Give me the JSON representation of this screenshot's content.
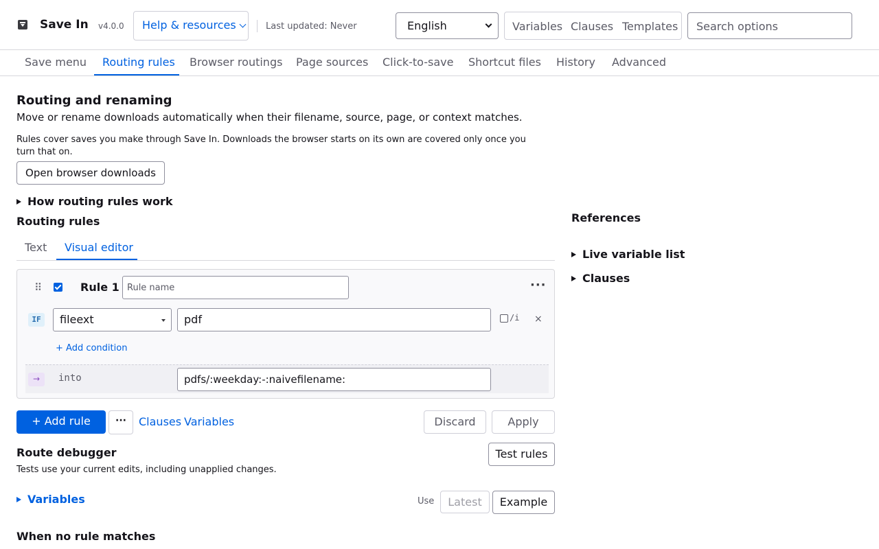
{
  "header": {
    "app_title": "Save In",
    "version": "v4.0.0",
    "help_label": "Help & resources",
    "last_updated": "Last updated: Never",
    "language": "English",
    "references": [
      "Variables",
      "Clauses",
      "Templates"
    ],
    "search_placeholder": "Search options"
  },
  "nav": {
    "tabs": [
      "Save menu",
      "Routing rules",
      "Browser routings",
      "Page sources",
      "Click-to-save",
      "Shortcut files",
      "History",
      "Advanced"
    ],
    "active": "Routing rules"
  },
  "main": {
    "title": "Routing and renaming",
    "intro": "Move or rename downloads automatically when their filename, source, page, or context matches.",
    "note": "Rules cover saves you make through Save In. Downloads the browser starts on its own are covered only once you turn that on.",
    "open_downloads_label": "Open browser downloads",
    "how_it_works": "How routing rules work",
    "routing_rules_heading": "Routing rules",
    "editor_tabs": [
      "Text",
      "Visual editor"
    ],
    "active_editor_tab": "Visual editor"
  },
  "rule": {
    "title": "Rule 1",
    "enabled": true,
    "name_placeholder": "Rule name",
    "more_label": "···",
    "condition_badge": "IF",
    "condition_field": "fileext",
    "condition_value": "pdf",
    "case_insensitive_label": "/i",
    "remove_label": "×",
    "add_condition_label": "+ Add condition",
    "arrow_badge": "→",
    "into_label": "into",
    "destination": "pdfs/:weekday:-:naivefilename:"
  },
  "actions": {
    "add_rule_label": "+ Add rule",
    "more_label": "···",
    "clauses_link": "Clauses",
    "variables_link": "Variables",
    "discard_label": "Discard",
    "apply_label": "Apply"
  },
  "debugger": {
    "heading": "Route debugger",
    "test_label": "Test rules",
    "note": "Tests use your current edits, including unapplied changes.",
    "variables_label": "Variables",
    "use_label": "Use",
    "latest_label": "Latest",
    "example_label": "Example"
  },
  "no_match_heading": "When no rule matches",
  "sidebar": {
    "heading": "References",
    "items": [
      "Live variable list",
      "Clauses"
    ]
  },
  "colors": {
    "accent": "#0061e0",
    "text": "#15141a",
    "muted": "#5b5b66",
    "border": "#d7d7db"
  }
}
